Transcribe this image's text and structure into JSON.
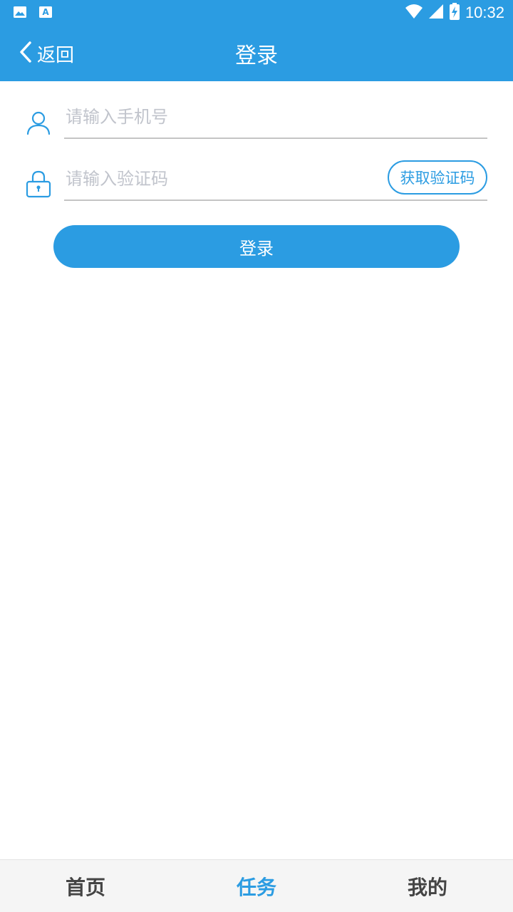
{
  "status_bar": {
    "time": "10:32",
    "icons": [
      "image-icon",
      "a-font-icon",
      "wifi-icon",
      "signal-icon",
      "battery-charging-icon"
    ]
  },
  "header": {
    "back_label": "返回",
    "title": "登录",
    "background": "#2b9ce2"
  },
  "form": {
    "phone_placeholder": "请输入手机号",
    "code_placeholder": "请输入验证码",
    "get_code_label": "获取验证码",
    "submit_label": "登录"
  },
  "bottom_nav": {
    "items": [
      {
        "label": "首页",
        "active": false
      },
      {
        "label": "任务",
        "active": true
      },
      {
        "label": "我的",
        "active": false
      }
    ]
  },
  "colors": {
    "accent": "#2b9ce2",
    "placeholder": "#c1c4cc",
    "nav_inactive": "#444444"
  }
}
